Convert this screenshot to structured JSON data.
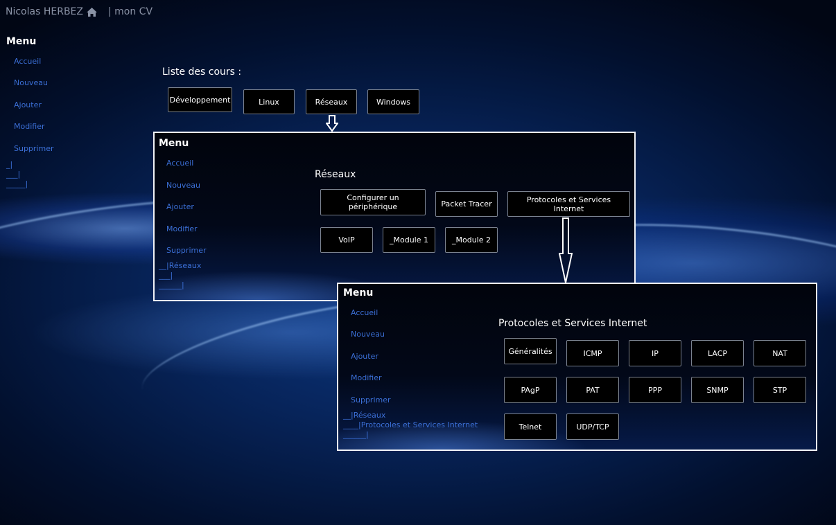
{
  "topbar": {
    "owner": "Nicolas HERBEZ",
    "cv": "| mon CV"
  },
  "main": {
    "menu": {
      "title": "Menu",
      "items": [
        "Accueil",
        "Nouveau",
        "Ajouter",
        "Modifier",
        "Supprimer"
      ],
      "crumbs": [
        "_|",
        "___|",
        "_____|"
      ]
    },
    "heading": "Liste des cours :",
    "courses": [
      "Développement",
      "Linux",
      "Réseaux",
      "Windows"
    ]
  },
  "panel1": {
    "menu": {
      "title": "Menu",
      "items": [
        "Accueil",
        "Nouveau",
        "Ajouter",
        "Modifier",
        "Supprimer"
      ],
      "crumbs": [
        "__|Réseaux",
        "___|",
        "______|"
      ]
    },
    "heading": "Réseaux",
    "buttons": [
      "Configurer un périphérique",
      "Packet Tracer",
      "Protocoles et Services Internet",
      "VoIP",
      "_Module 1",
      "_Module 2"
    ]
  },
  "panel2": {
    "menu": {
      "title": "Menu",
      "items": [
        "Accueil",
        "Nouveau",
        "Ajouter",
        "Modifier",
        "Supprimer"
      ],
      "crumbs": [
        "__|Réseaux",
        "____|Protocoles et Services Internet",
        "______|"
      ]
    },
    "heading": "Protocoles et Services Internet",
    "buttons": [
      "Généralités",
      "ICMP",
      "IP",
      "LACP",
      "NAT",
      "PAgP",
      "PAT",
      "PPP",
      "SNMP",
      "STP",
      "Telnet",
      "UDP/TCP"
    ]
  },
  "icons": {
    "home": "home-icon",
    "arrow": "arrow-down-icon"
  }
}
